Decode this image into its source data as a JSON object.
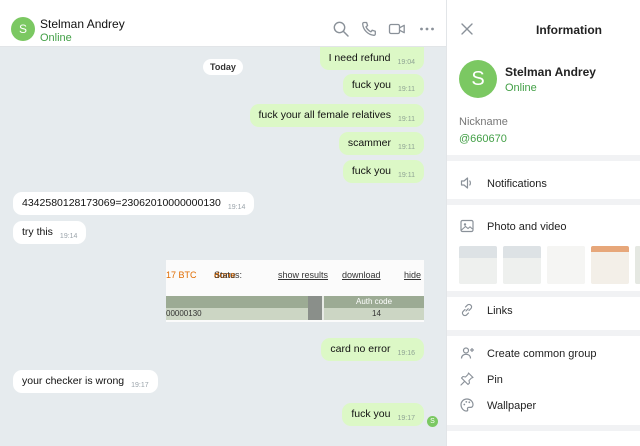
{
  "contact": {
    "name": "Stelman Andrey",
    "status": "Online",
    "avatar_letter": "S",
    "avatar_color": "#7bc862"
  },
  "header_icons": [
    "search-icon",
    "phone-icon",
    "video-call-icon",
    "more-icon"
  ],
  "date_separator": "Today",
  "messages": [
    {
      "dir": "out",
      "text": "I need refund",
      "time": "19:04"
    },
    {
      "dir": "out",
      "text": "fuck you",
      "time": "19:11"
    },
    {
      "dir": "out",
      "text": "fuck your all female relatives",
      "time": "19:11"
    },
    {
      "dir": "out",
      "text": "scammer",
      "time": "19:11"
    },
    {
      "dir": "out",
      "text": "fuck you",
      "time": "19:11"
    },
    {
      "dir": "in",
      "text": "4342580128173069=23062010000000130",
      "time": "19:14"
    },
    {
      "dir": "in",
      "text": "try this",
      "time": "19:14"
    },
    {
      "dir": "out",
      "text": "card no error",
      "time": "19:16"
    },
    {
      "dir": "in",
      "text": "your checker is wrong",
      "time": "19:17"
    },
    {
      "dir": "out",
      "text": "fuck you",
      "time": "19:17"
    }
  ],
  "screenshot": {
    "amount": "17 BTC",
    "status_label": "Status:",
    "status_value": "done",
    "show_results": "show results",
    "download": "download",
    "hide": "hide",
    "col_header": "Auth code",
    "cell_number": "00000130",
    "cell_code": "14"
  },
  "info": {
    "title": "Information",
    "nickname_label": "Nickname",
    "nickname_value": "@660670",
    "items": {
      "notifications": "Notifications",
      "photo_video": "Photo and video",
      "links": "Links",
      "common_group": "Create common group",
      "pin": "Pin",
      "wallpaper": "Wallpaper"
    }
  },
  "colors": {
    "accent_green": "#43a047",
    "outgoing_bubble": "#dcf8c6",
    "chat_background": "#e6ebee",
    "status_done": "#e06c00"
  }
}
